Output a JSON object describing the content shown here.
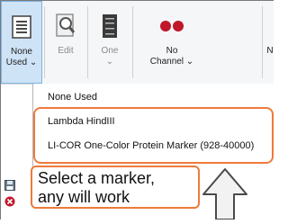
{
  "ribbon": {
    "buttons": [
      {
        "label_line1": "None",
        "label_line2": "Used ⌄",
        "icon": "marker-list-icon"
      },
      {
        "label_line1": "Edit",
        "label_line2": "",
        "icon": "edit-magnifier-icon"
      },
      {
        "label_line1": "One",
        "label_line2": "⌄",
        "icon": "lane-strip-icon"
      },
      {
        "label_line1": "No",
        "label_line2": "Channel ⌄",
        "icon": "channel-dots-icon"
      },
      {
        "label_line1": "N",
        "label_line2": "",
        "icon": ""
      }
    ],
    "colors": {
      "channel_dot": "#c0172a",
      "active_bg": "#cfe3f6"
    }
  },
  "dropdown": {
    "items": [
      "None Used",
      "Lambda HindIII",
      "LI-COR One-Color Protein Marker (928-40000)"
    ]
  },
  "callout": {
    "line1": "Select a marker,",
    "line2": "any will work",
    "accent_color": "#ee7a3b"
  }
}
